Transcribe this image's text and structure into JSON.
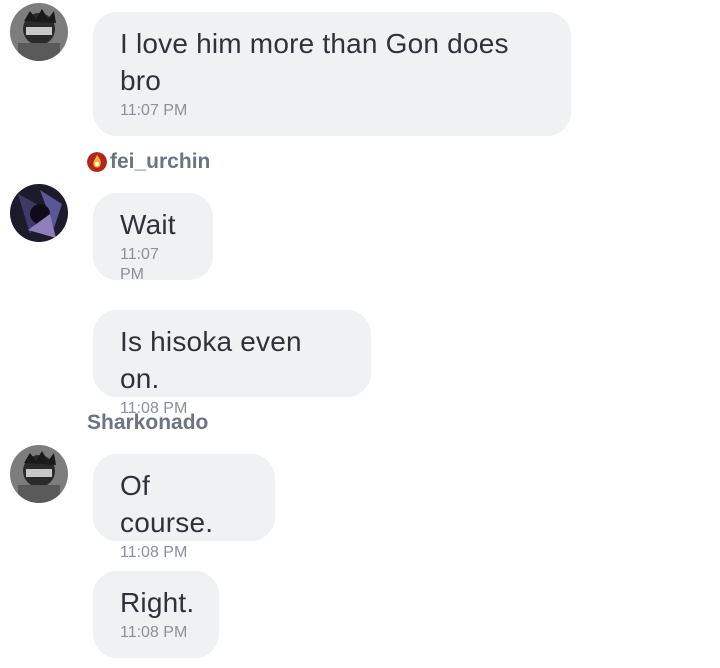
{
  "messages": [
    {
      "text": "I love him more than Gon does bro",
      "time": "11:07 PM"
    },
    {
      "text": "Wait",
      "time": "11:07 PM"
    },
    {
      "text": "Is hisoka even on.",
      "time": "11:08 PM"
    },
    {
      "text": "Of course.",
      "time": "11:08 PM"
    },
    {
      "text": "Right.",
      "time": "11:08 PM"
    }
  ],
  "senders": {
    "fei": {
      "name": "fei_urchin",
      "icon": "fire-avatar-icon"
    },
    "shark": {
      "name": "Sharkonado"
    }
  },
  "colors": {
    "bubble": "#f0f1f3",
    "sender_name": "#6b7480",
    "timestamp": "#8a8f98"
  }
}
